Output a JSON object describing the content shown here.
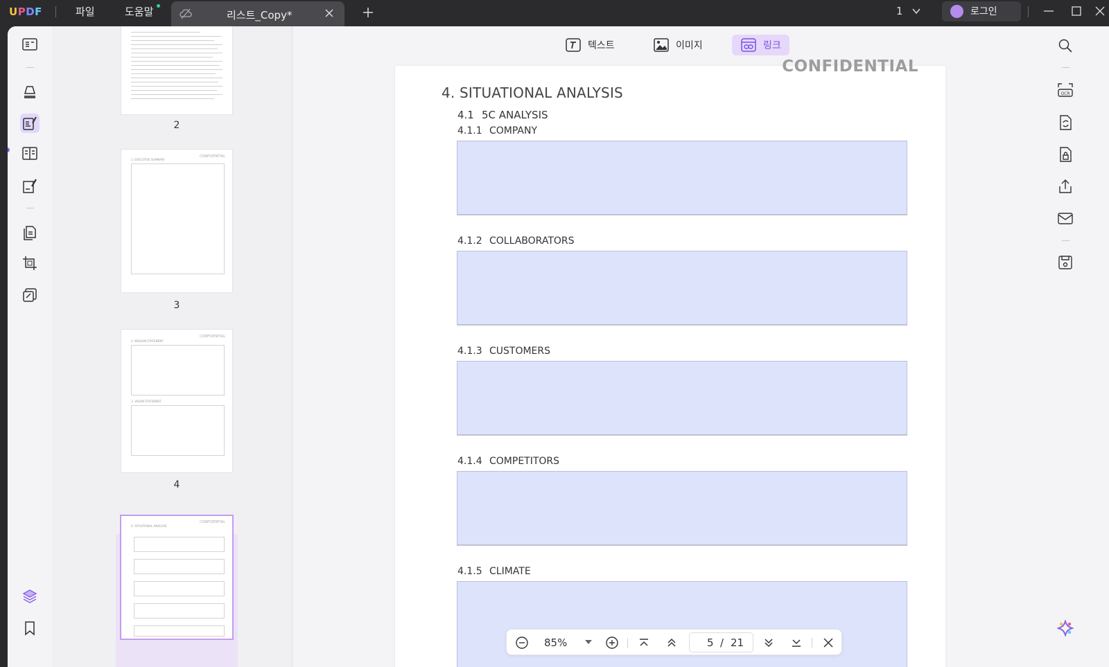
{
  "titlebar": {
    "logo": [
      "U",
      "P",
      "D",
      "F"
    ],
    "menu": {
      "file": "파일",
      "help": "도움말"
    },
    "tab_title": "리스트_Copy*",
    "page_count": "1",
    "login_label": "로그인"
  },
  "left_rail": {
    "icons": [
      "reader-icon",
      "highlighter-icon",
      "edit-pdf-icon",
      "form-icon",
      "sign-icon",
      "organize-pages-icon",
      "crop-icon",
      "stamp-icon",
      "layers-icon",
      "bookmark-icon"
    ],
    "active": "edit-pdf-icon"
  },
  "thumbnails": [
    {
      "number": "2",
      "confidential": ""
    },
    {
      "number": "3",
      "confidential": "CONFIDENTIAL",
      "heading": "1. EXECUTIVE SUMMARY"
    },
    {
      "number": "4",
      "confidential": "CONFIDENTIAL",
      "heading": "2. MISSION STATEMENT",
      "heading2": "3. VISION STATEMENT"
    },
    {
      "number": "5",
      "confidential": "CONFIDENTIAL",
      "heading": "4. SITUATIONAL ANALYSIS",
      "selected": true
    }
  ],
  "edit_toolbar": {
    "text": "텍스트",
    "image": "이미지",
    "link": "링크",
    "active": "link"
  },
  "document": {
    "confidential": "CONFIDENTIAL",
    "heading": "4.  SITUATIONAL ANALYSIS",
    "subheading": {
      "number": "4.1",
      "title": "5C ANALYSIS"
    },
    "sections": [
      {
        "number": "4.1.1",
        "title": "COMPANY"
      },
      {
        "number": "4.1.2",
        "title": "COLLABORATORS"
      },
      {
        "number": "4.1.3",
        "title": "CUSTOMERS"
      },
      {
        "number": "4.1.4",
        "title": "COMPETITORS"
      },
      {
        "number": "4.1.5",
        "title": "CLIMATE"
      }
    ]
  },
  "zoom_bar": {
    "zoom": "85%",
    "current_page": "5",
    "separator": "/",
    "total_pages": "21"
  },
  "right_rail": {
    "icons": [
      "search-icon",
      "ocr-icon",
      "convert-icon",
      "protect-icon",
      "share-icon",
      "email-icon",
      "save-icon",
      "ai-assistant-icon"
    ]
  },
  "colors": {
    "accent": "#8a63e6",
    "field_fill": "#dde3fb",
    "titlebar": "#2b2b2e"
  }
}
